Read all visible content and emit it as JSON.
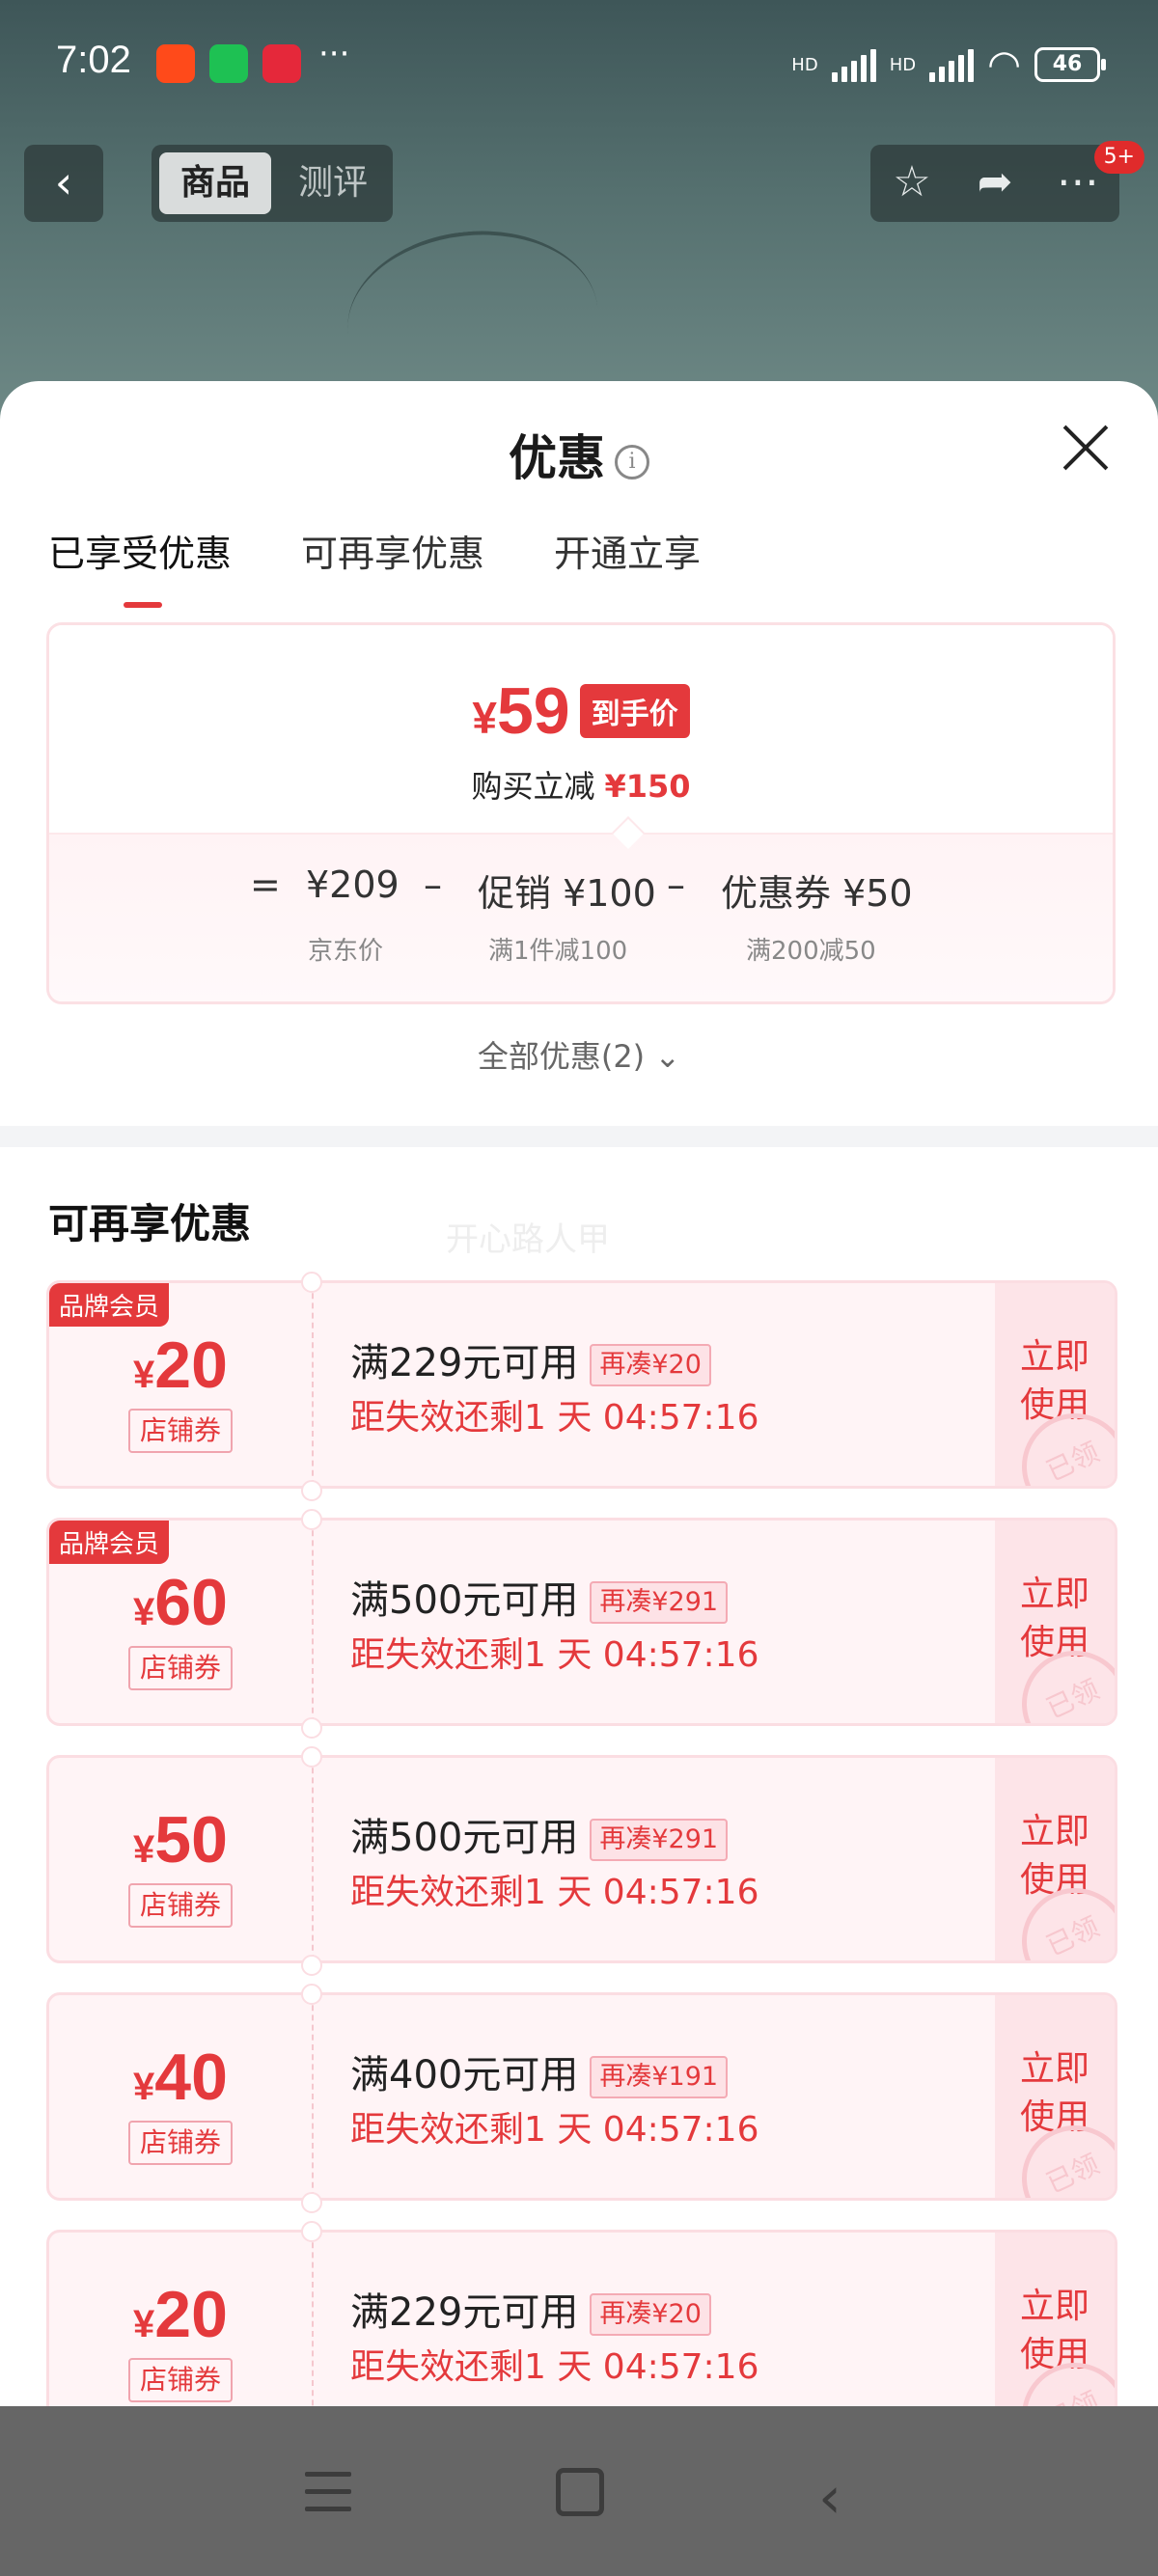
{
  "status_bar": {
    "time": "7:02",
    "network1": "HD",
    "network2": "HD",
    "battery": "46",
    "app_icons": [
      "taobao-icon",
      "wechat-icon",
      "taobao-special-icon"
    ],
    "more": "···"
  },
  "top_nav": {
    "tabs": [
      "商品",
      "测评"
    ],
    "badge": "5+"
  },
  "sheet": {
    "title": "优惠",
    "info": "i",
    "tabs": [
      "已享受优惠",
      "可再享优惠",
      "开通立享"
    ],
    "summary": {
      "price_currency": "¥",
      "price_value": "59",
      "price_tag": "到手价",
      "reduce_label": "购买立减",
      "reduce_value": "¥150",
      "equals": "=",
      "minus": "–",
      "jd_price": "¥209",
      "jd_price_label": "京东价",
      "promo": "促销 ¥100",
      "promo_label": "满1件减100",
      "coupon": "优惠券 ¥50",
      "coupon_label": "满200减50"
    },
    "all_offers": "全部优惠(2)",
    "section_title": "可再享优惠",
    "watermark": "开心路人甲",
    "coupons": [
      {
        "brand": "品牌会员",
        "yen": "¥",
        "amount": "20",
        "kind": "店铺券",
        "condition": "满229元可用",
        "extra": "再凑¥20",
        "time": "距失效还剩1 天 04:57:16",
        "use": "立即使用",
        "stamp": "已领"
      },
      {
        "brand": "品牌会员",
        "yen": "¥",
        "amount": "60",
        "kind": "店铺券",
        "condition": "满500元可用",
        "extra": "再凑¥291",
        "time": "距失效还剩1 天 04:57:16",
        "use": "立即使用",
        "stamp": "已领"
      },
      {
        "brand": "",
        "yen": "¥",
        "amount": "50",
        "kind": "店铺券",
        "condition": "满500元可用",
        "extra": "再凑¥291",
        "time": "距失效还剩1 天 04:57:16",
        "use": "立即使用",
        "stamp": "已领"
      },
      {
        "brand": "",
        "yen": "¥",
        "amount": "40",
        "kind": "店铺券",
        "condition": "满400元可用",
        "extra": "再凑¥191",
        "time": "距失效还剩1 天 04:57:16",
        "use": "立即使用",
        "stamp": "已领"
      },
      {
        "brand": "",
        "yen": "¥",
        "amount": "20",
        "kind": "店铺券",
        "condition": "满229元可用",
        "extra": "再凑¥20",
        "time": "距失效还剩1 天 04:57:16",
        "use": "立即使用",
        "stamp": "已领"
      }
    ]
  },
  "colors": {
    "accent": "#e4393c",
    "coupon_bg": "#fff4f6"
  }
}
